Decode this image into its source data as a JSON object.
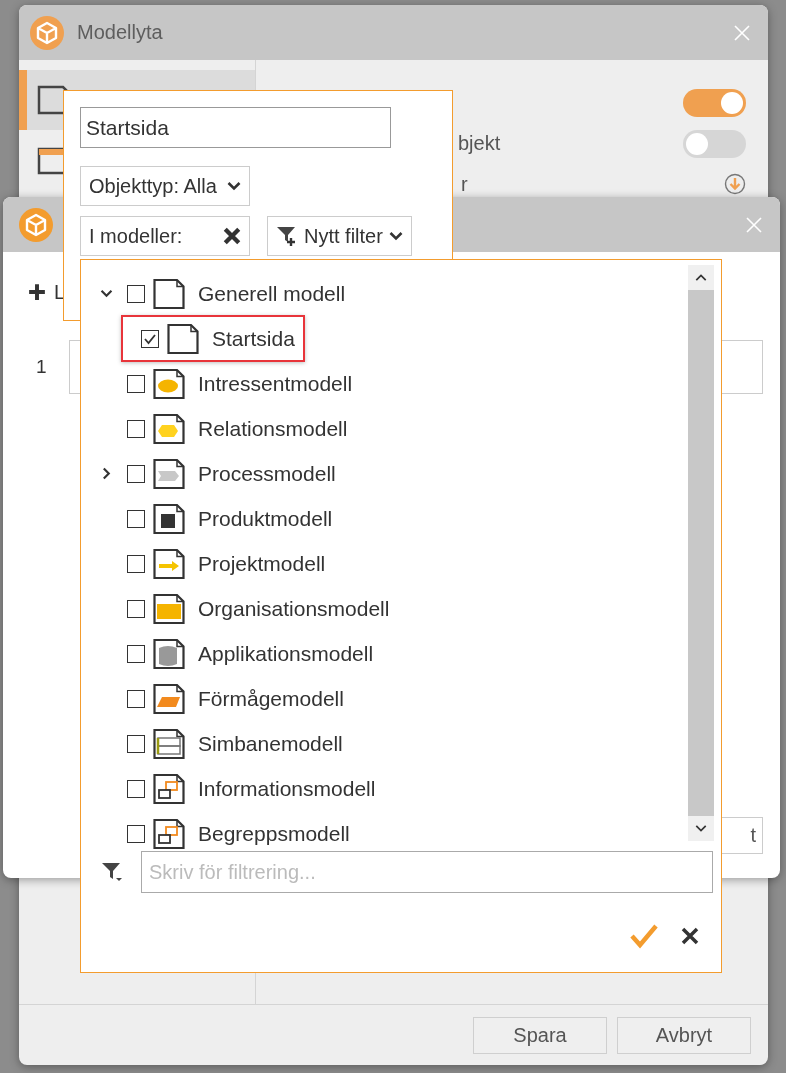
{
  "back_window": {
    "title": "Modellyta",
    "toggles": [
      {
        "on": true
      },
      {
        "on": false
      }
    ],
    "label_fragments": [
      "bjekt",
      "r"
    ],
    "buttons": [
      "Spara",
      "Avbryt"
    ]
  },
  "front_window": {
    "add_label": "L",
    "row_number": "1",
    "button_fragment": "t"
  },
  "filter_popup": {
    "name_value": "Startsida",
    "type_select": "Objekttyp: Alla",
    "models_filter": "I modeller:",
    "new_filter": "Nytt filter"
  },
  "tree_popup": {
    "items": [
      {
        "label": "Generell modell",
        "kind": "page",
        "checked": false,
        "expanded": true,
        "children": [
          {
            "label": "Startsida",
            "kind": "page",
            "checked": true,
            "highlighted": true
          }
        ]
      },
      {
        "label": "Intressentmodell",
        "kind": "ellipse",
        "checked": false
      },
      {
        "label": "Relationsmodell",
        "kind": "hexagon",
        "checked": false
      },
      {
        "label": "Processmodell",
        "kind": "process",
        "checked": false,
        "expanded": false
      },
      {
        "label": "Produktmodell",
        "kind": "square",
        "checked": false
      },
      {
        "label": "Projektmodell",
        "kind": "arrow",
        "checked": false
      },
      {
        "label": "Organisationsmodell",
        "kind": "block",
        "checked": false
      },
      {
        "label": "Applikationsmodell",
        "kind": "cylinder",
        "checked": false
      },
      {
        "label": "Förmågemodell",
        "kind": "parallelogram",
        "checked": false
      },
      {
        "label": "Simbanemodell",
        "kind": "lanes",
        "checked": false
      },
      {
        "label": "Informationsmodell",
        "kind": "linked",
        "checked": false
      },
      {
        "label": "Begreppsmodell",
        "kind": "linked",
        "checked": false
      }
    ],
    "filter_placeholder": "Skriv för filtrering..."
  }
}
